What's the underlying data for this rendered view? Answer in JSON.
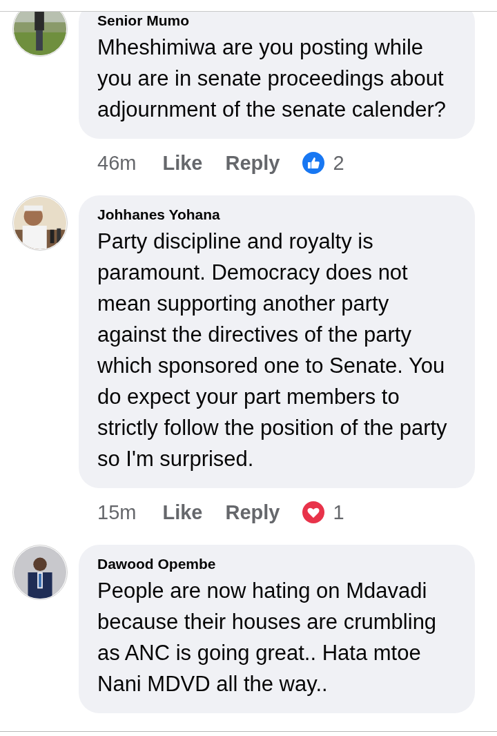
{
  "comments": [
    {
      "author": "Senior Mumo",
      "text": "Mheshimiwa are you posting while you are in senate proceedings about adjournment of the senate calender?",
      "time": "46m",
      "like": "Like",
      "reply": "Reply",
      "reaction": {
        "kind": "like",
        "count": "2"
      }
    },
    {
      "author": "Johhanes Yohana",
      "text": "Party discipline and royalty is paramount. Democracy does not mean supporting another party against the directives of the party which sponsored one to Senate. You do expect your part members to strictly follow the position of the party so I'm surprised.",
      "time": "15m",
      "like": "Like",
      "reply": "Reply",
      "reaction": {
        "kind": "love",
        "count": "1"
      }
    },
    {
      "author": "Dawood Opembe",
      "text": "People are now hating on Mdavadi because their houses are crumbling as ANC is going great.. Hata mtoe Nani MDVD all the way.."
    }
  ]
}
